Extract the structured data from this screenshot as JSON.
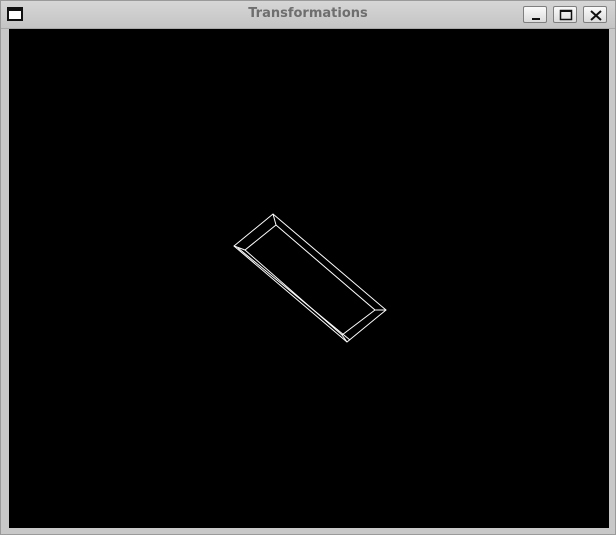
{
  "window": {
    "title": "Transformations",
    "controls": {
      "minimize_icon": "minimize-icon",
      "maximize_icon": "maximize-icon",
      "close_icon": "close-icon"
    }
  },
  "canvas": {
    "background": "#000000",
    "stroke": "#ffffff",
    "shape": "wireframe-box"
  }
}
